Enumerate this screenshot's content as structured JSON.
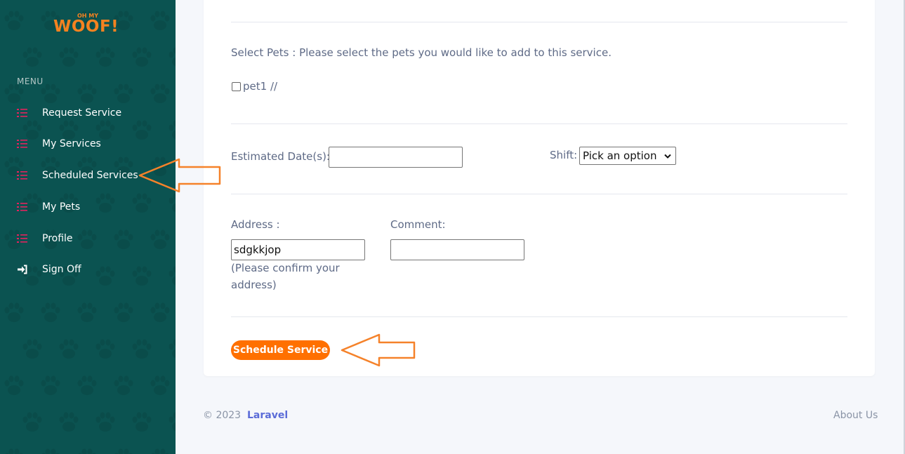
{
  "brand": {
    "logo_small": "OH MY",
    "logo_main": "WOOF!"
  },
  "sidebar": {
    "menu_title": "MENU",
    "items": [
      {
        "label": "Request Service",
        "icon": "list-icon"
      },
      {
        "label": "My Services",
        "icon": "list-icon"
      },
      {
        "label": "Scheduled Services",
        "icon": "list-icon"
      },
      {
        "label": "My Pets",
        "icon": "list-icon"
      },
      {
        "label": "Profile",
        "icon": "list-icon"
      },
      {
        "label": "Sign Off",
        "icon": "sign-in-icon"
      }
    ]
  },
  "form": {
    "select_pets_text": "Select Pets : Please select the pets you would like to add to this service.",
    "pet_option_label": "pet1 //",
    "pet_option_checked": false,
    "estimated_dates_label": "Estimated Date(s):",
    "estimated_dates_value": "",
    "shift_label": "Shift:",
    "shift_selected": "Pick an option",
    "address_label": "Address :",
    "address_value": "sdgkkjop",
    "address_hint_line1": "(Please confirm your",
    "address_hint_line2": "address)",
    "comment_label": "Comment:",
    "comment_value": "",
    "submit_label": "Schedule Service"
  },
  "footer": {
    "copyright": "© 2023",
    "link": "Laravel",
    "about": "About Us"
  },
  "colors": {
    "sidebar_bg": "#0b5351",
    "accent": "#ff7000",
    "icon_red": "#e0245e",
    "annotation_arrow": "#f5822a"
  }
}
